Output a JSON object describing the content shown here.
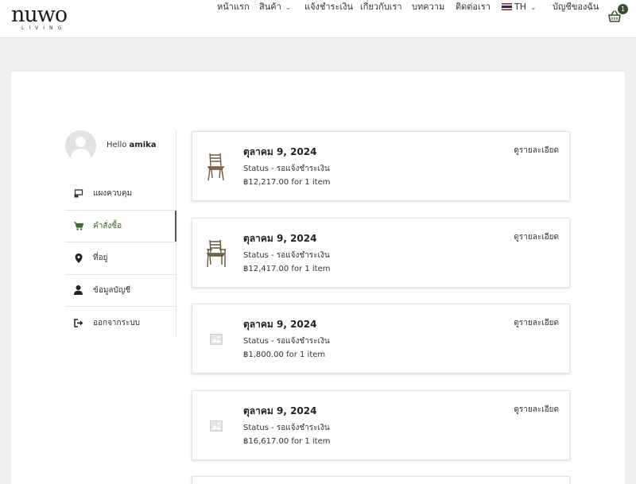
{
  "brand": {
    "name": "NUWO",
    "sub": "LIVING"
  },
  "nav": {
    "items": [
      {
        "label": "หน้าแรก",
        "dropdown": false
      },
      {
        "label": "สินค้า",
        "dropdown": true
      },
      {
        "label": "แจ้งชำระเงิน",
        "dropdown": false
      },
      {
        "label": "เกี่ยวกับเรา",
        "dropdown": false
      },
      {
        "label": "บทความ",
        "dropdown": false
      },
      {
        "label": "ติดต่อเรา",
        "dropdown": false
      },
      {
        "label": "TH",
        "dropdown": true,
        "icon": "thai-flag-icon"
      },
      {
        "label": "บัญชีของฉัน",
        "dropdown": false
      }
    ],
    "cart_count": "1"
  },
  "profile": {
    "hello": "Hello",
    "username": "amika"
  },
  "sidebar": {
    "items": [
      {
        "label": "แผงควบคุม",
        "icon": "dashboard-icon",
        "active": false
      },
      {
        "label": "คำสั่งซื้อ",
        "icon": "cart-icon",
        "active": true
      },
      {
        "label": "ที่อยู่",
        "icon": "location-pin-icon",
        "active": false
      },
      {
        "label": "ข้อมูลบัญชี",
        "icon": "user-icon",
        "active": false
      },
      {
        "label": "ออกจากระบบ",
        "icon": "logout-icon",
        "active": false
      }
    ]
  },
  "orders": [
    {
      "date": "ตุลาคม 9, 2024",
      "status": "Status - รอแจ้งชำระเงิน",
      "total": "฿12,217.00 for 1 item",
      "detail": "ดูรายละเอียด",
      "thumb": "chair-icon"
    },
    {
      "date": "ตุลาคม 9, 2024",
      "status": "Status - รอแจ้งชำระเงิน",
      "total": "฿12,417.00 for 1 item",
      "detail": "ดูรายละเอียด",
      "thumb": "armchair-icon"
    },
    {
      "date": "ตุลาคม 9, 2024",
      "status": "Status - รอแจ้งชำระเงิน",
      "total": "฿1,800.00 for 1 item",
      "detail": "ดูรายละเอียด",
      "thumb": "image-placeholder-icon"
    },
    {
      "date": "ตุลาคม 9, 2024",
      "status": "Status - รอแจ้งชำระเงิน",
      "total": "฿16,617.00 for 1 item",
      "detail": "ดูรายละเอียด",
      "thumb": "image-placeholder-icon"
    }
  ],
  "colors": {
    "accent": "#3d6b2a",
    "badge": "#3d4d31",
    "page_bg": "#efefef"
  }
}
